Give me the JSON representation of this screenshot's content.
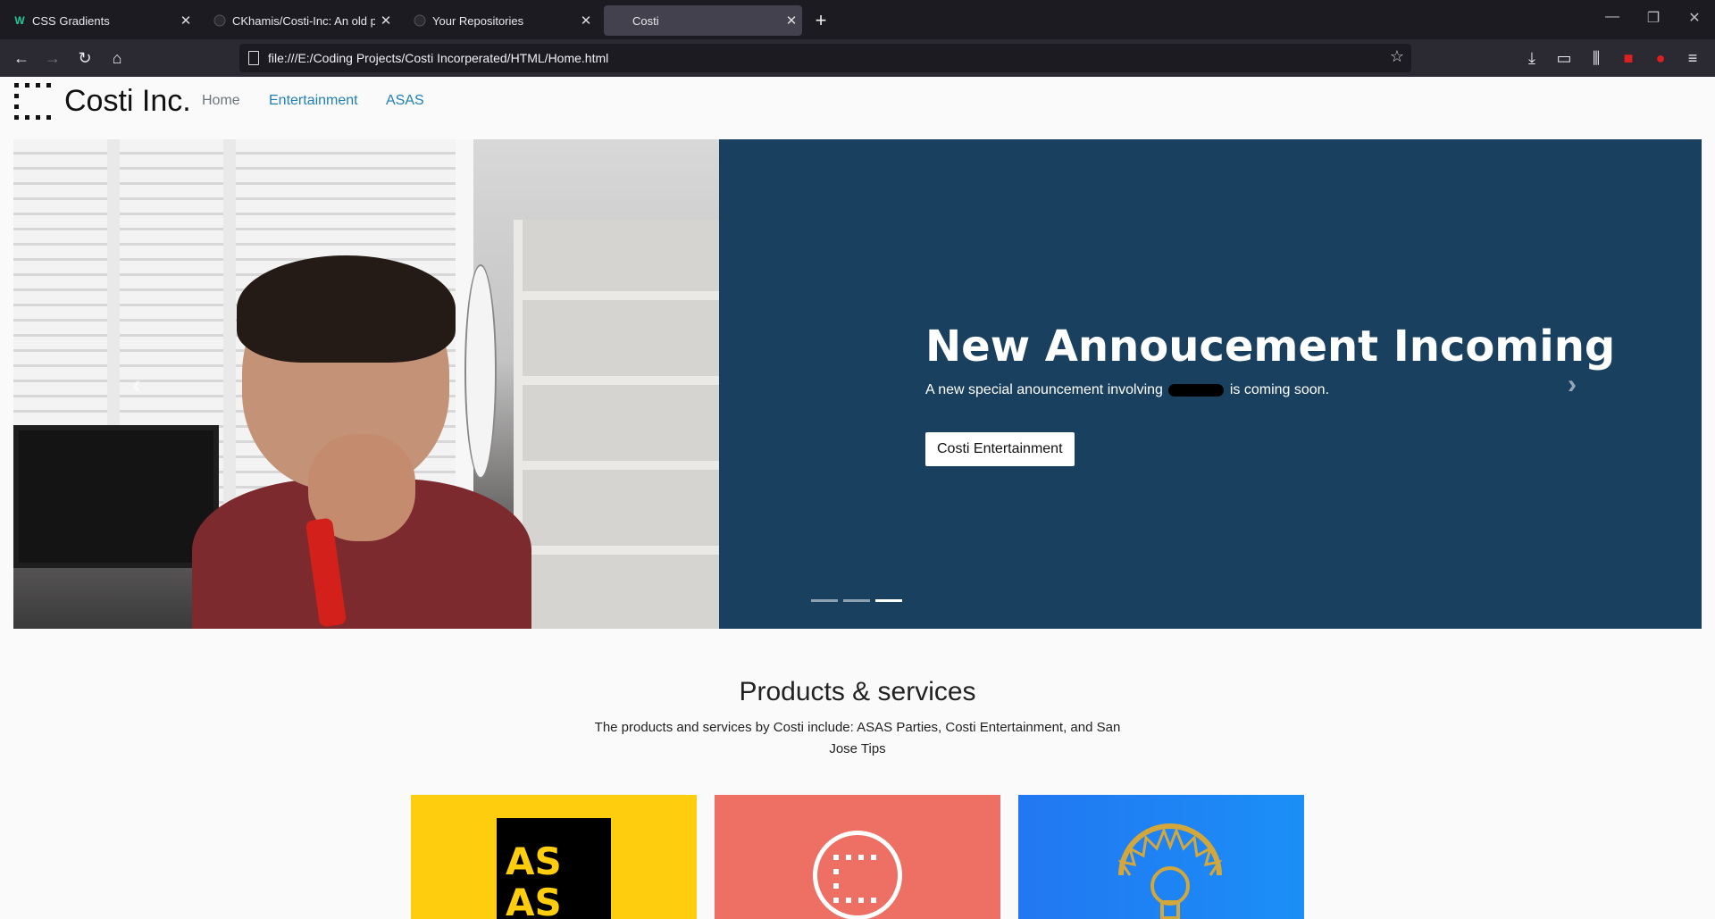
{
  "browser": {
    "tabs": [
      {
        "title": "CSS Gradients",
        "icon": "w-logo-icon",
        "close": "✕"
      },
      {
        "title": "CKhamis/Costi-Inc: An old proj",
        "icon": "github-icon",
        "close": "✕"
      },
      {
        "title": "Your Repositories",
        "icon": "github-icon",
        "close": "✕"
      },
      {
        "title": "Costi",
        "icon": "",
        "close": "✕"
      }
    ],
    "new_tab": "+",
    "url": "file:///E:/Coding Projects/Costi Incorperated/HTML/Home.html"
  },
  "page": {
    "brand": "Costi Inc.",
    "nav": [
      {
        "label": "Home",
        "color": "#6c757d"
      },
      {
        "label": "Entertainment",
        "color": "#1f7fb8"
      },
      {
        "label": "ASAS",
        "color": "#1f7fb8"
      }
    ],
    "carousel": {
      "title": "New Annoucement Incoming",
      "text_before": "A new special anouncement involving",
      "text_after": "is coming soon.",
      "button": "Costi Entertainment",
      "prev_icon": "‹",
      "next_icon": "›",
      "active_indicator": 3,
      "indicator_count": 3
    },
    "section": {
      "title": "Products & services",
      "text": "The products and services by Costi include: ASAS Parties, Costi Entertainment, and San Jose Tips"
    },
    "cards": [
      {
        "name": "ASAS",
        "logo_text": "AS AS",
        "bg": "#fece0e"
      },
      {
        "name": "Costi Entertainment",
        "bg": "#ee6f63"
      },
      {
        "name": "San Jose Tips",
        "bg": "#1f84f4"
      }
    ]
  }
}
